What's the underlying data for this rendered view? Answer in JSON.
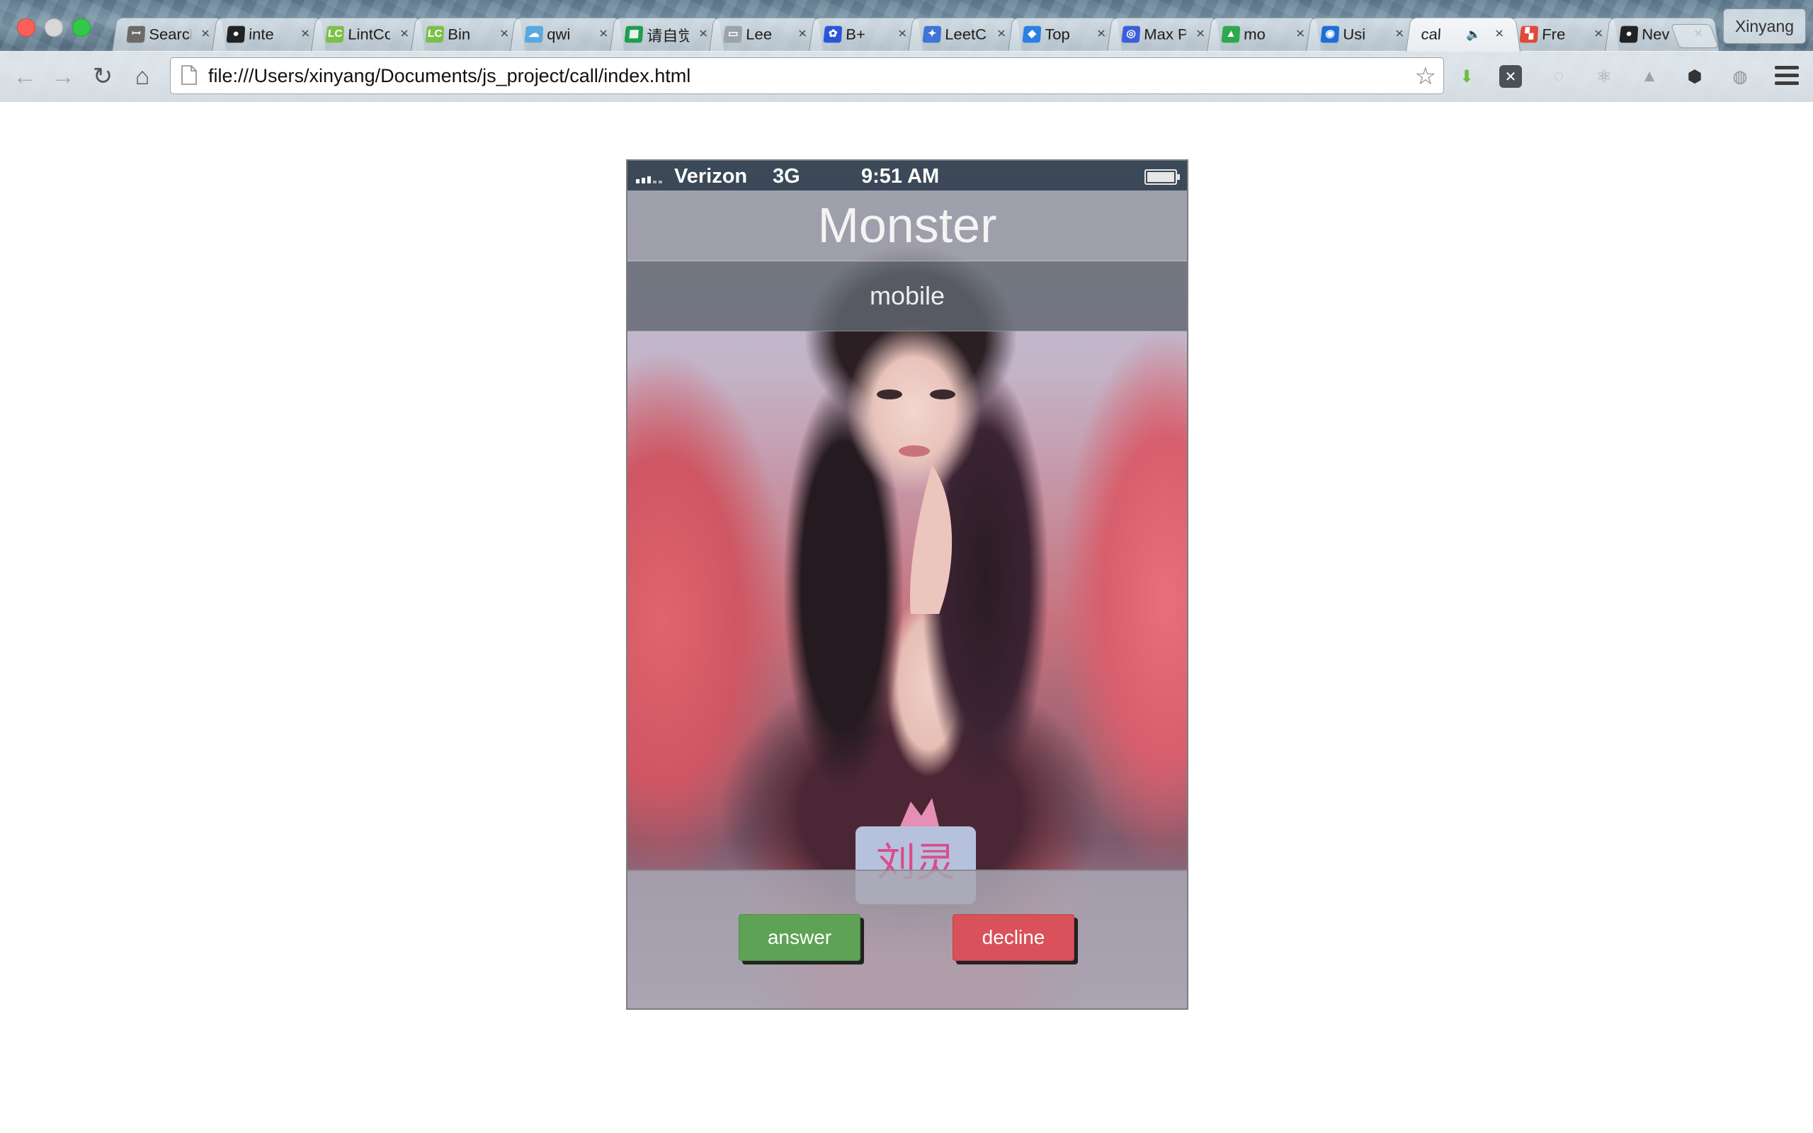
{
  "browser": {
    "tabs": [
      {
        "label": "Search",
        "icon_text": "ꟷ",
        "icon_color": "#6a6a6a"
      },
      {
        "label": "inte",
        "icon_text": "●",
        "icon_color": "#222222"
      },
      {
        "label": "LintCo",
        "icon_text": "LC",
        "icon_color": "#7cc04a"
      },
      {
        "label": "Bin",
        "icon_text": "LC",
        "icon_color": "#7cc04a"
      },
      {
        "label": "qwi",
        "icon_text": "☁",
        "icon_color": "#5aa8e0"
      },
      {
        "label": "请自觉",
        "icon_text": "▦",
        "icon_color": "#1e9e4e"
      },
      {
        "label": "Lee",
        "icon_text": "▭",
        "icon_color": "#9aa3ab"
      },
      {
        "label": "B+",
        "icon_text": "✿",
        "icon_color": "#2b55d8"
      },
      {
        "label": "LeetC",
        "icon_text": "✦",
        "icon_color": "#3f74d6"
      },
      {
        "label": "Top",
        "icon_text": "◆",
        "icon_color": "#2d7fe0"
      },
      {
        "label": "Max P",
        "icon_text": "◎",
        "icon_color": "#3c5ed8"
      },
      {
        "label": "mo",
        "icon_text": "▲",
        "icon_color": "#2ea84f"
      },
      {
        "label": "Usi",
        "icon_text": "◉",
        "icon_color": "#1d6fd6"
      },
      {
        "label": "cal",
        "icon_text": "",
        "icon_color": "#ffffff",
        "active": true,
        "audio": "🔈"
      },
      {
        "label": "Fre",
        "icon_text": "▚",
        "icon_color": "#e04a3a"
      },
      {
        "label": "Nev",
        "icon_text": "●",
        "icon_color": "#222222"
      }
    ],
    "close_glyph": "×",
    "profile_name": "Xinyang",
    "url": "file:///Users/xinyang/Documents/js_project/call/index.html",
    "nav": {
      "back": "←",
      "forward": "→",
      "reload": "↻",
      "home": "⌂",
      "star": "☆"
    },
    "extensions": [
      {
        "name": "download-arrow-icon",
        "glyph": "⬇",
        "color": "#67c23a"
      },
      {
        "name": "x-extension-icon",
        "glyph": "✕",
        "color": "#ffffff"
      },
      {
        "name": "sync-icon",
        "glyph": "◌",
        "color": "#b8bec3"
      },
      {
        "name": "react-icon",
        "glyph": "⚛",
        "color": "#9aa2a8"
      },
      {
        "name": "drive-icon",
        "glyph": "▲",
        "color": "#9aa2a8"
      },
      {
        "name": "shield-icon",
        "glyph": "⬢",
        "color": "#333333"
      },
      {
        "name": "globe-icon",
        "glyph": "◍",
        "color": "#8a8f94"
      }
    ]
  },
  "phone": {
    "status": {
      "carrier": "Verizon",
      "network": "3G",
      "time": "9:51 AM"
    },
    "caller": {
      "name": "Monster",
      "type": "mobile"
    },
    "photo_badge_text": "刘灵",
    "actions": {
      "answer": "answer",
      "decline": "decline"
    },
    "colors": {
      "answer": "#5ea355",
      "decline": "#d9515a"
    }
  }
}
